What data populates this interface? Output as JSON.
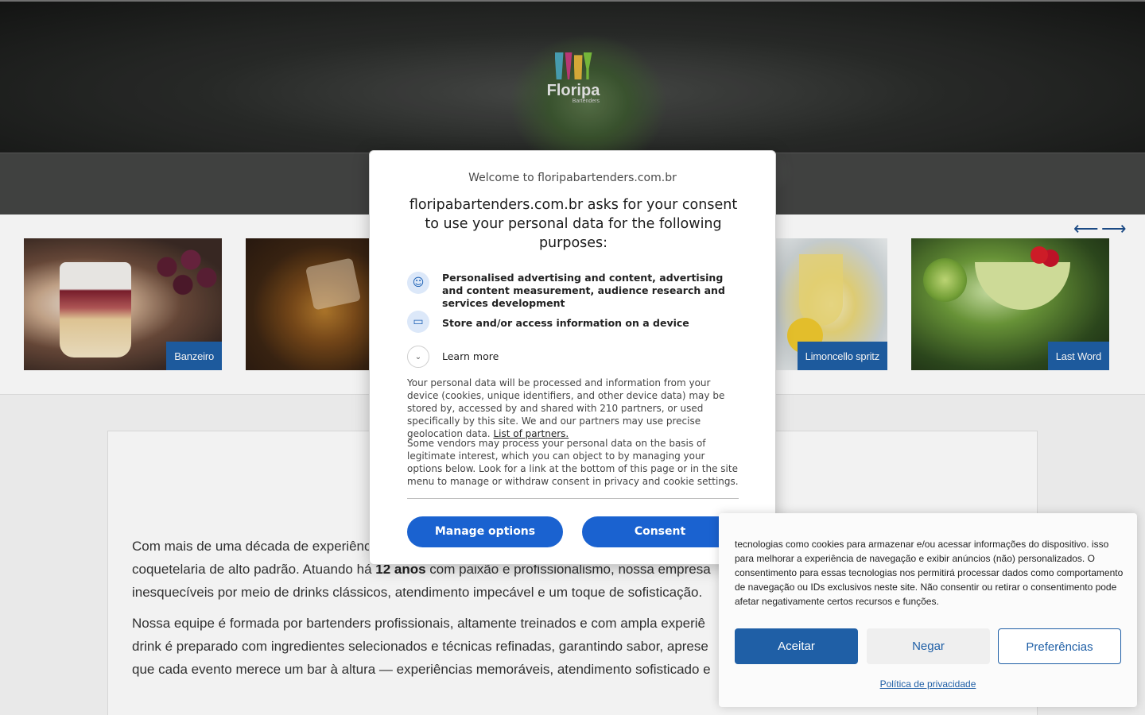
{
  "logo": {
    "brand": "Floripa",
    "sub": "Bartenders"
  },
  "carousel": {
    "prev_icon": "arrow-left-icon",
    "next_icon": "arrow-right-icon",
    "items": [
      {
        "label": "Banzeiro"
      },
      {
        "label": ""
      },
      {
        "label": "Limoncello spritz"
      },
      {
        "label": "Last Word"
      }
    ]
  },
  "content": {
    "p1_a": "Com mais de uma década de experiênc",
    "p1_b": "coquetelaria de alto padrão. Atuando há ",
    "p1_bold": "12 anos",
    "p1_c": " com paixão e profissionalismo, nossa empresa",
    "p1_d": "inesquecíveis por meio de drinks clássicos, atendimento impecável e um toque de sofisticação.",
    "p2_a": "Nossa equipe é formada por bartenders profissionais, altamente treinados e com ampla experiê",
    "p2_b": "drink é preparado com ingredientes selecionados e técnicas refinadas, garantindo sabor, aprese",
    "p2_c": "que cada evento merece um bar à altura — experiências memoráveis, atendimento sofisticado e"
  },
  "consent_modal": {
    "welcome": "Welcome to floripabartenders.com.br",
    "headline": "floripabartenders.com.br asks for your consent to use your personal data for the following purposes:",
    "purposes": [
      {
        "icon": "person-icon",
        "text": "Personalised advertising and content, advertising and content measurement, audience research and services development"
      },
      {
        "icon": "device-icon",
        "text": "Store and/or access information on a device"
      }
    ],
    "learn_more": "Learn more",
    "body1": "Your personal data will be processed and information from your device (cookies, unique identifiers, and other device data) may be stored by, accessed by and shared with 210 partners, or used specifically by this site. We and our partners may use precise geolocation data. ",
    "partners_link": "List of partners.",
    "body2": "Some vendors may process your personal data on the basis of legitimate interest, which you can object to by managing your options below. Look for a link at the bottom of this page or in the site menu to manage or withdraw consent in privacy and cookie settings.",
    "manage_label": "Manage options",
    "consent_label": "Consent"
  },
  "cookie_banner": {
    "text": "tecnologias como cookies para armazenar e/ou acessar informações do dispositivo. isso para melhorar a experiência de navegação e exibir anúncios (não) personalizados. O consentimento para essas tecnologias nos permitirá processar dados como comportamento de navegação ou IDs exclusivos neste site. Não consentir ou retirar o consentimento pode afetar negativamente certos recursos e funções.",
    "accept_label": "Aceitar",
    "deny_label": "Negar",
    "prefs_label": "Preferências",
    "policy_label": "Política de privacidade"
  },
  "colors": {
    "primary_blue": "#1a62d0",
    "site_blue": "#1f5fa6"
  }
}
